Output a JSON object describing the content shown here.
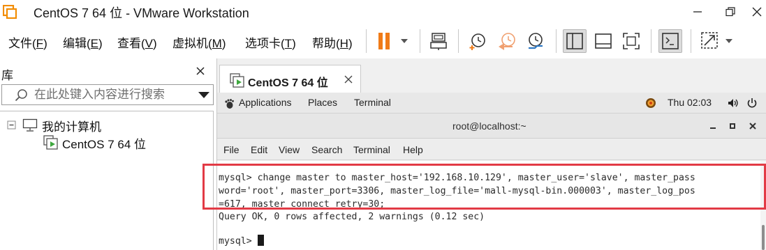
{
  "window": {
    "title": "CentOS 7 64 位 - VMware Workstation",
    "brand_color": "#f28c00"
  },
  "menu": [
    {
      "label": "文件(",
      "key": "F",
      "end": ")"
    },
    {
      "label": "编辑(",
      "key": "E",
      "end": ")"
    },
    {
      "label": "查看(",
      "key": "V",
      "end": ")"
    },
    {
      "label": "虚拟机(",
      "key": "M",
      "end": ")"
    },
    {
      "label": "选项卡(",
      "key": "T",
      "end": ")"
    },
    {
      "label": "帮助(",
      "key": "H",
      "end": ")"
    }
  ],
  "toolbar": {
    "icons": [
      "pause-icon",
      "send-ctrl-alt-del-icon",
      "snapshot-take-icon",
      "snapshot-revert-icon",
      "snapshot-manager-icon",
      "library-view-icon",
      "thumbnail-view-icon",
      "full-screen-icon",
      "console-view-icon",
      "unity-view-icon"
    ],
    "pause_color": "#f07b18"
  },
  "library": {
    "title": "库",
    "search_placeholder": "在此处键入内容进行搜索",
    "tree": {
      "root": "我的计算机",
      "children": [
        "CentOS 7 64 位"
      ]
    }
  },
  "tab": {
    "label": "CentOS 7 64 位"
  },
  "guest": {
    "panel": {
      "applications": "Applications",
      "places": "Places",
      "terminal": "Terminal",
      "clock": "Thu 02:03"
    },
    "terminal": {
      "title": "root@localhost:~",
      "menu": [
        "File",
        "Edit",
        "View",
        "Search",
        "Terminal",
        "Help"
      ],
      "lines": [
        "mysql> change master to master_host='192.168.10.129', master_user='slave', master_pass",
        "word='root', master_port=3306, master_log_file='mall-mysql-bin.000003', master_log_pos",
        "=617, master_connect_retry=30;",
        "Query OK, 0 rows affected, 2 warnings (0.12 sec)",
        "",
        "mysql> "
      ]
    }
  },
  "colors": {
    "highlight_border": "#e23a45",
    "accent_green": "#3fa83f"
  }
}
